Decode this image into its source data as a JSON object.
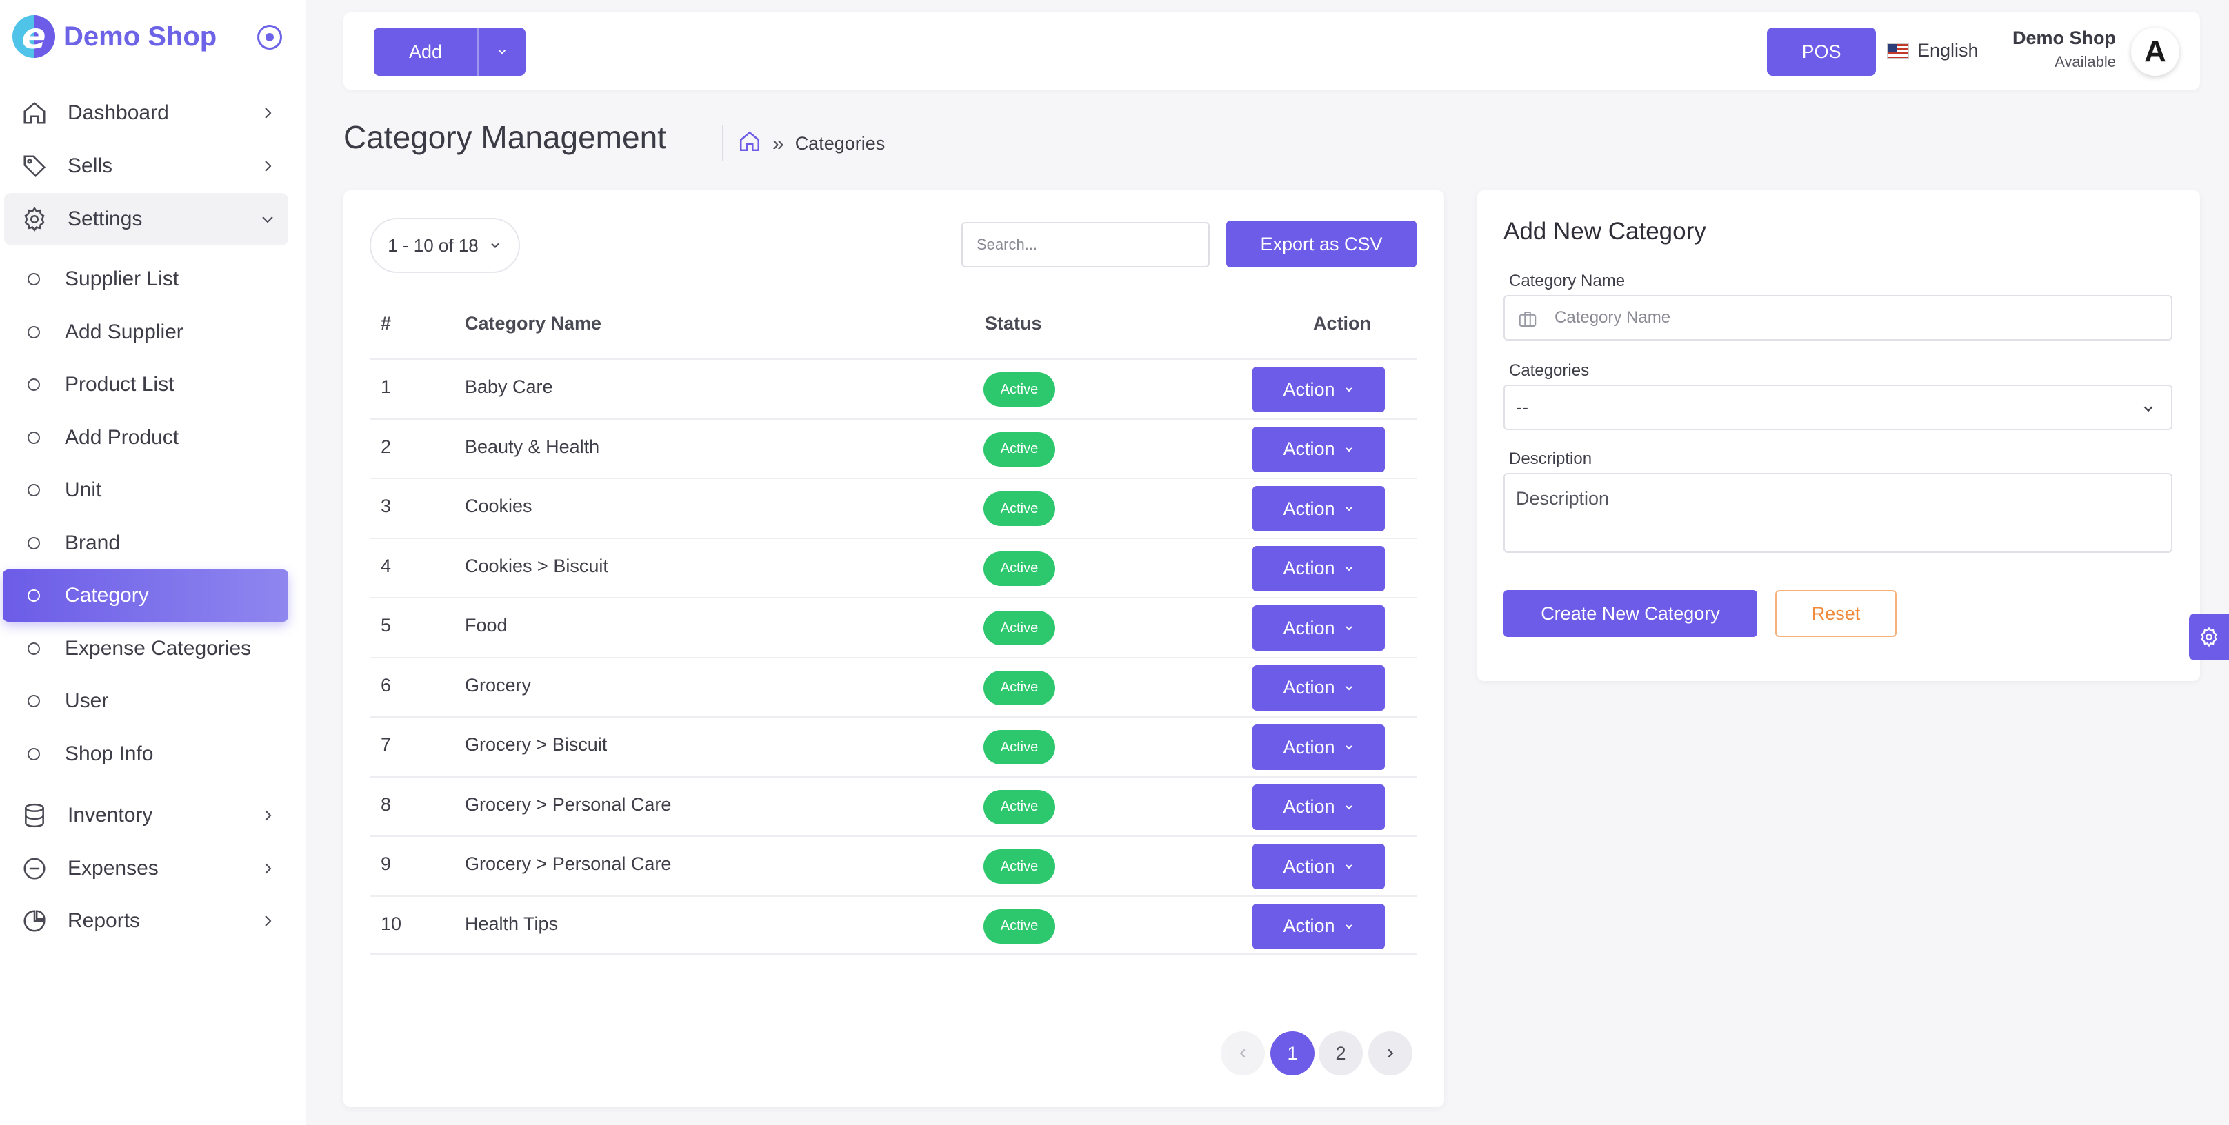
{
  "brand": {
    "name": "Demo Shop",
    "logo_letter": "e",
    "accent": "#6c5ce7"
  },
  "sidebar": {
    "main_items": [
      {
        "label": "Dashboard",
        "icon": "home-icon"
      },
      {
        "label": "Sells",
        "icon": "tag-icon"
      },
      {
        "label": "Settings",
        "icon": "gear-icon",
        "expanded": true
      }
    ],
    "sub_items": [
      {
        "label": "Supplier List"
      },
      {
        "label": "Add Supplier"
      },
      {
        "label": "Product List"
      },
      {
        "label": "Add Product"
      },
      {
        "label": "Unit"
      },
      {
        "label": "Brand"
      },
      {
        "label": "Category",
        "active": true
      },
      {
        "label": "Expense Categories"
      },
      {
        "label": "User"
      },
      {
        "label": "Shop Info"
      }
    ],
    "bottom_items": [
      {
        "label": "Inventory",
        "icon": "database-icon"
      },
      {
        "label": "Expenses",
        "icon": "minus-circle-icon"
      },
      {
        "label": "Reports",
        "icon": "pie-chart-icon"
      }
    ]
  },
  "topbar": {
    "add_label": "Add",
    "pos_label": "POS",
    "language": "English",
    "shop_name": "Demo Shop",
    "shop_status": "Available",
    "avatar_letter": "A"
  },
  "page": {
    "title": "Category Management",
    "breadcrumb_current": "Categories"
  },
  "list": {
    "per_page": "1 - 10 of 18",
    "search_placeholder": "Search...",
    "export_label": "Export as CSV",
    "headers": {
      "num": "#",
      "name": "Category Name",
      "status": "Status",
      "action": "Action"
    },
    "rows": [
      {
        "num": "1",
        "name": "Baby Care",
        "status": "Active",
        "action": "Action"
      },
      {
        "num": "2",
        "name": "Beauty & Health",
        "status": "Active",
        "action": "Action"
      },
      {
        "num": "3",
        "name": "Cookies",
        "status": "Active",
        "action": "Action"
      },
      {
        "num": "4",
        "name": "Cookies > Biscuit",
        "status": "Active",
        "action": "Action"
      },
      {
        "num": "5",
        "name": "Food",
        "status": "Active",
        "action": "Action"
      },
      {
        "num": "6",
        "name": "Grocery",
        "status": "Active",
        "action": "Action"
      },
      {
        "num": "7",
        "name": "Grocery > Biscuit",
        "status": "Active",
        "action": "Action"
      },
      {
        "num": "8",
        "name": "Grocery > Personal Care",
        "status": "Active",
        "action": "Action"
      },
      {
        "num": "9",
        "name": "Grocery > Personal Care",
        "status": "Active",
        "action": "Action"
      },
      {
        "num": "10",
        "name": "Health Tips",
        "status": "Active",
        "action": "Action"
      }
    ],
    "pagination": {
      "pages": [
        "1",
        "2"
      ],
      "current": "1"
    }
  },
  "form": {
    "title": "Add New Category",
    "name_label": "Category Name",
    "name_placeholder": "Category Name",
    "categories_label": "Categories",
    "categories_value": "--",
    "description_label": "Description",
    "description_placeholder": "Description",
    "create_label": "Create New Category",
    "reset_label": "Reset"
  },
  "colors": {
    "accent": "#6c5ce7",
    "success": "#2dc76d",
    "reset": "#f08a3c"
  }
}
